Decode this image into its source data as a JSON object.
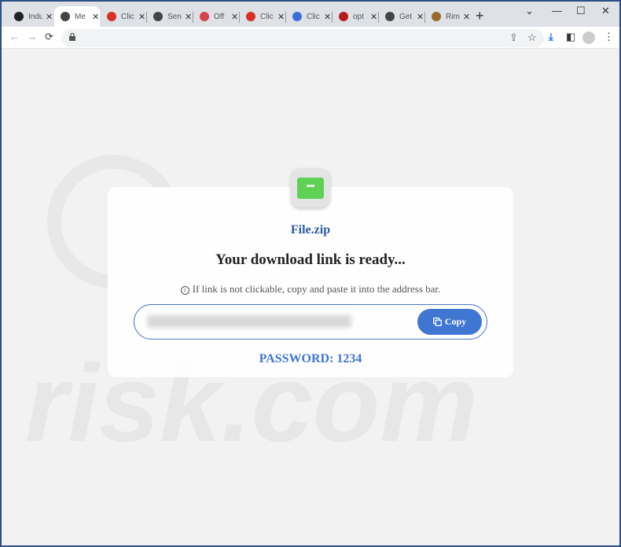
{
  "tabs": [
    {
      "label": "Indu",
      "color": "#222"
    },
    {
      "label": "Me",
      "color": "#444",
      "active": true
    },
    {
      "label": "Clic",
      "color": "#d93025"
    },
    {
      "label": "Sen",
      "color": "#444"
    },
    {
      "label": "Off",
      "color": "#d9434b"
    },
    {
      "label": "Clic",
      "color": "#d93025"
    },
    {
      "label": "Clic",
      "color": "#3b6fd6"
    },
    {
      "label": "opt",
      "color": "#b71c1c"
    },
    {
      "label": "Get",
      "color": "#444"
    },
    {
      "label": "Rim",
      "color": "#9a6a2c"
    }
  ],
  "tab_close": "✕",
  "new_tab": "+",
  "window_controls": {
    "dropdown": "⌄",
    "minimize": "—",
    "maximize": "☐",
    "close": "✕"
  },
  "toolbar": {
    "back": "←",
    "forward": "→",
    "reload": "⟳",
    "share": "⇪",
    "bookmark": "☆",
    "download": "⤓",
    "sidepanel": "◧",
    "menu": "⋮"
  },
  "watermark": "risk.com",
  "card": {
    "file_name": "File.zip",
    "heading": "Your download link is ready...",
    "info_icon": "i",
    "hint": "If link is not clickable, copy and paste it into the address bar.",
    "copy_label": "Copy",
    "password": "PASSWORD: 1234"
  },
  "colors": {
    "accent": "#3f76d2",
    "title": "#2d5aa0",
    "file_icon": "#5fd155"
  }
}
